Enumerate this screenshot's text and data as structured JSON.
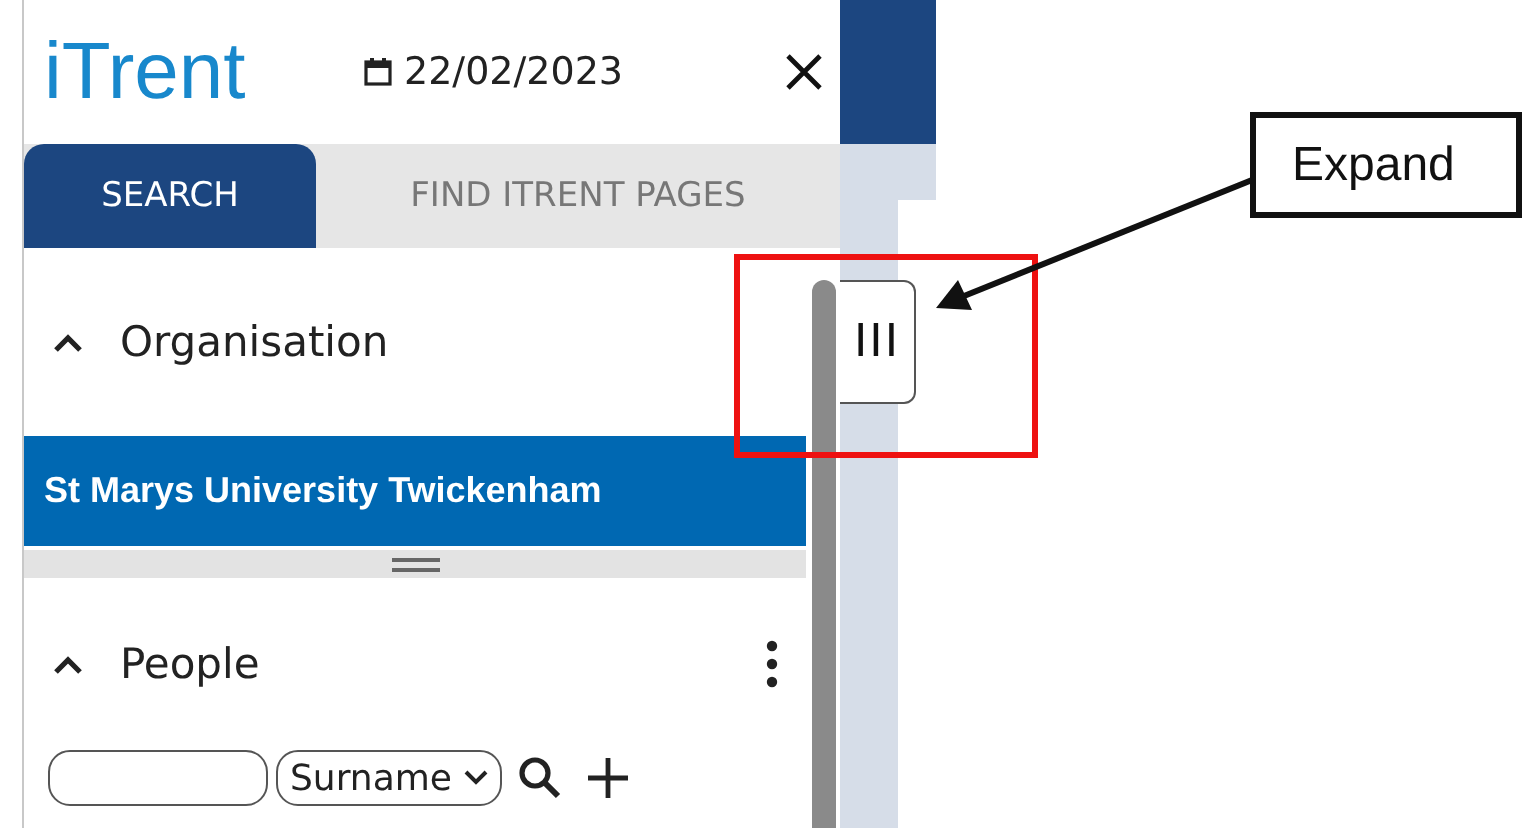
{
  "logo": "iTrent",
  "date": "22/02/2023",
  "tabs": [
    {
      "label": "SEARCH",
      "selected": true
    },
    {
      "label": "FIND ITRENT PAGES",
      "selected": false
    }
  ],
  "sections": [
    {
      "title": "Organisation",
      "expanded": true,
      "items": [
        {
          "label": "St Marys University Twickenham",
          "selected": true
        }
      ]
    },
    {
      "title": "People",
      "expanded": true,
      "search": {
        "select_value": "Surname"
      }
    }
  ],
  "expand_handle": {
    "label": "III"
  },
  "callout": {
    "text": "Expand"
  }
}
